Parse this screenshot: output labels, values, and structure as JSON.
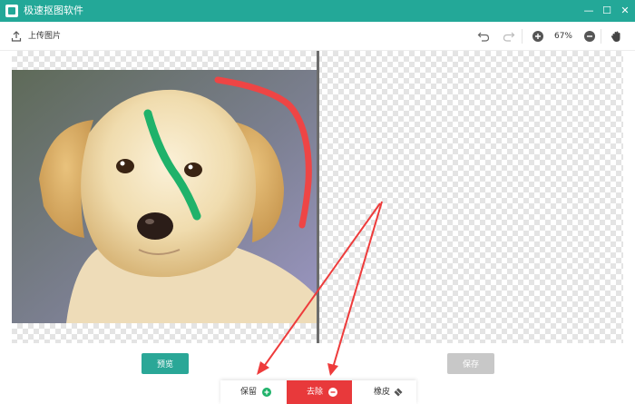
{
  "window": {
    "title": "极速抠图软件",
    "minimize_glyph": "—",
    "maximize_glyph": "☐",
    "close_glyph": "✕"
  },
  "toolbar": {
    "upload_label": "上传图片",
    "zoom_level": "67%",
    "icons": [
      "upload-icon",
      "undo-icon",
      "redo-icon",
      "zoom-in-icon",
      "zoom-out-icon",
      "hand-icon"
    ]
  },
  "actions": {
    "preview_label": "预览",
    "save_label": "保存"
  },
  "modes": {
    "keep_label": "保留",
    "remove_label": "去除",
    "eraser_label": "橡皮",
    "active": "去除"
  },
  "colors": {
    "accent": "#23a898",
    "remove_active": "#e8393b",
    "keep_stroke": "#1fb26a",
    "remove_stroke": "#ee4545",
    "save_disabled": "#c8c8c8"
  }
}
